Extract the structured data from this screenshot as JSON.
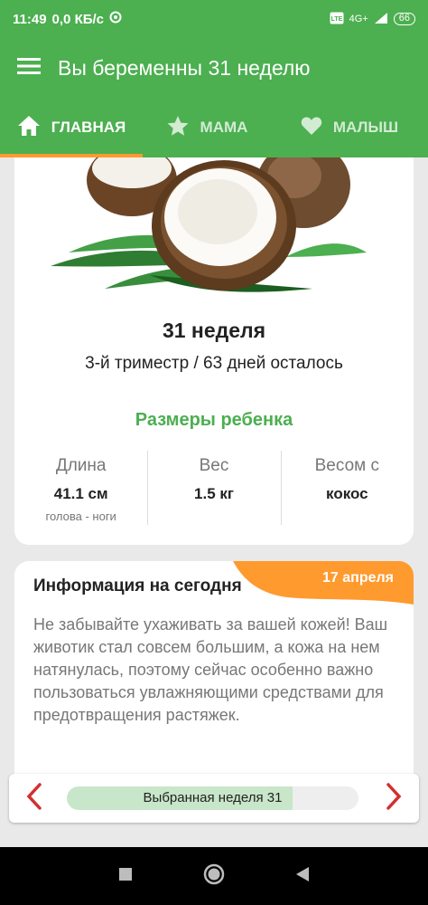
{
  "status_bar": {
    "time": "11:49",
    "data_speed": "0,0 КБ/с",
    "network_label": "4G+",
    "battery": "66"
  },
  "app_bar": {
    "title": "Вы беременны 31 неделю"
  },
  "tabs": [
    {
      "label": "ГЛАВНАЯ",
      "icon": "home-icon",
      "active": true
    },
    {
      "label": "МАМА",
      "icon": "star-icon",
      "active": false
    },
    {
      "label": "МАЛЫШ",
      "icon": "heart-icon",
      "active": false
    }
  ],
  "week_card": {
    "image": "coconut",
    "title": "31 неделя",
    "subtitle": "3-й триместр / 63 дней осталось",
    "sizes_title": "Размеры ребенка",
    "stats": [
      {
        "label": "Длина",
        "value": "41.1 см",
        "note": "голова - ноги"
      },
      {
        "label": "Вес",
        "value": "1.5 кг",
        "note": ""
      },
      {
        "label": "Весом с",
        "value": "кокос",
        "note": ""
      }
    ]
  },
  "info_card": {
    "title": "Информация на сегодня",
    "date": "17 апреля",
    "text": "Не забывайте ухаживать за вашей кожей! Ваш животик стал совсем большим, а кожа на нем натянулась, поэтому сейчас особенно важно пользоваться увлажняющими средствами для предотвращения растяжек."
  },
  "week_selector": {
    "label": "Выбранная неделя 31",
    "progress": 0.775
  },
  "colors": {
    "primary": "#4caf50",
    "accent": "#ff9a2e",
    "arrow": "#d32f2f",
    "progress_fill": "#c8e6c9"
  }
}
